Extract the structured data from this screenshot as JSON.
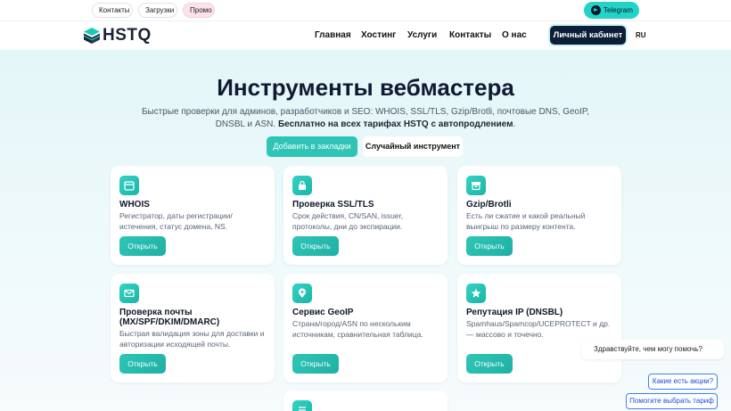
{
  "topbar": {
    "links": [
      "Контакты",
      "Загрузки",
      "Промо"
    ],
    "telegram": "Telegram"
  },
  "nav": {
    "logo": "HSTQ",
    "items": [
      "Главная",
      "Хостинг",
      "Услуги",
      "Контакты",
      "О нас"
    ],
    "cabinet": "Личный кабинет",
    "lang": "RU"
  },
  "hero": {
    "title": "Инструменты вебмастера",
    "subtitle": "Быстрые проверки для админов, разработчиков и SEO: WHOIS, SSL/TLS, Gzip/Brotli, почтовые DNS, GeoIP, DNSBL и ASN.",
    "subtitle_bold": "Бесплатно на всех тарифах HSTQ с автопродлением",
    "subtitle_end": ".",
    "bookmark_button": "Добавить в закладки",
    "random_button": "Случайный инструмент"
  },
  "cards": [
    {
      "title": "WHOIS",
      "desc": "Регистратор, даты регистрации/ истечения, статус домена, NS.",
      "button": "Открыть",
      "icon": "calendar-icon"
    },
    {
      "title": "Проверка SSL/TLS",
      "desc": "Срок действия, CN/SAN, issuer, протоколы, дни до экспирации.",
      "button": "Открыть",
      "icon": "lock-icon"
    },
    {
      "title": "Gzip/Brotli",
      "desc": "Есть ли сжатие и какой реальный выигрыш по размеру контента.",
      "button": "Открыть",
      "icon": "archive-icon"
    },
    {
      "title": "Проверка почты (MX/SPF/DKIM/DMARC)",
      "desc": "Быстрая валидация зоны для доставки и авторизации исходящей почты.",
      "button": "Открыть",
      "icon": "mail-icon"
    },
    {
      "title": "Сервис GeoIP",
      "desc": "Страна/город/ASN по нескольким источникам, сравнительная таблица.",
      "button": "Открыть",
      "icon": "map-pin-icon"
    },
    {
      "title": "Репутация IP (DNSBL)",
      "desc": "Spamhaus/Spamcop/UCEPROTECT и др. — массово и точечно.",
      "button": "Открыть",
      "icon": "star-icon"
    }
  ],
  "chat": {
    "greeting": "Здравствуйте, чем могу помочь?",
    "option1": "Какие есть акции?",
    "option2": "Помогите выбрать тариф"
  }
}
